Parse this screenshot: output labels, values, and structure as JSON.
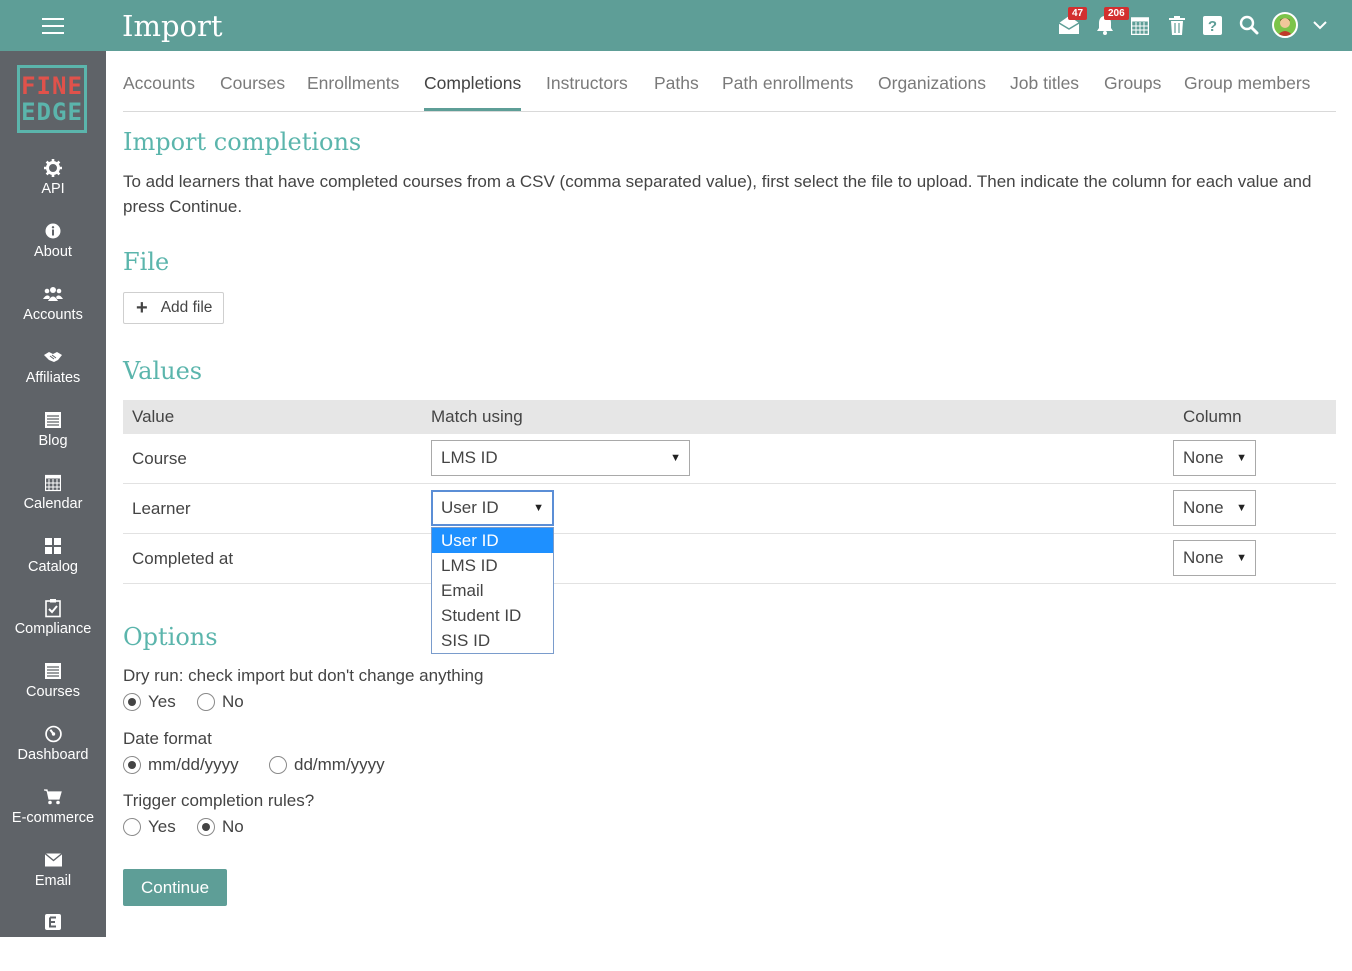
{
  "header": {
    "title": "Import",
    "messages_badge": "47",
    "notifications_badge": "206"
  },
  "sidebar": {
    "logo_line1": "FINE",
    "logo_line2": "EDGE",
    "items": [
      {
        "label": "API",
        "icon": "gear-icon"
      },
      {
        "label": "About",
        "icon": "info-icon"
      },
      {
        "label": "Accounts",
        "icon": "users-icon"
      },
      {
        "label": "Affiliates",
        "icon": "handshake-icon"
      },
      {
        "label": "Blog",
        "icon": "blog-icon"
      },
      {
        "label": "Calendar",
        "icon": "calendar-icon"
      },
      {
        "label": "Catalog",
        "icon": "grid-icon"
      },
      {
        "label": "Compliance",
        "icon": "clipboard-check-icon"
      },
      {
        "label": "Courses",
        "icon": "list-icon"
      },
      {
        "label": "Dashboard",
        "icon": "dashboard-icon"
      },
      {
        "label": "E-commerce",
        "icon": "cart-icon"
      },
      {
        "label": "Email",
        "icon": "envelope-icon"
      }
    ]
  },
  "tabs": [
    "Accounts",
    "Courses",
    "Enrollments",
    "Completions",
    "Instructors",
    "Paths",
    "Path enrollments",
    "Organizations",
    "Job titles",
    "Groups",
    "Group members"
  ],
  "active_tab": "Completions",
  "main": {
    "heading": "Import completions",
    "description": "To add learners that have completed courses from a CSV (comma separated value), first select the file to upload. Then indicate the column for each value and press Continue.",
    "file_heading": "File",
    "add_file_label": "Add file",
    "values_heading": "Values",
    "table": {
      "headers": [
        "Value",
        "Match using",
        "Column"
      ],
      "rows": [
        {
          "value": "Course",
          "match": "LMS ID",
          "column": "None"
        },
        {
          "value": "Learner",
          "match": "User ID",
          "column": "None"
        },
        {
          "value": "Completed at",
          "match": "",
          "column": "None"
        }
      ]
    },
    "dropdown_options": [
      "User ID",
      "LMS ID",
      "Email",
      "Student ID",
      "SIS ID"
    ],
    "dropdown_selected": "User ID",
    "options_heading": "Options",
    "dry_run": {
      "question": "Dry run: check import but don't change anything",
      "yes": "Yes",
      "no": "No",
      "selected": "Yes"
    },
    "date_format": {
      "question": "Date format",
      "opt1": "mm/dd/yyyy",
      "opt2": "dd/mm/yyyy",
      "selected": "mm/dd/yyyy"
    },
    "trigger": {
      "question": "Trigger completion rules?",
      "yes": "Yes",
      "no": "No",
      "selected": "No"
    },
    "continue_label": "Continue"
  },
  "colors": {
    "topbar": "#5e9e97",
    "sidebar": "#5f6368",
    "accent": "#5bb5ac",
    "badge": "#d32f2f",
    "dropdown_highlight": "#1e90ff"
  }
}
